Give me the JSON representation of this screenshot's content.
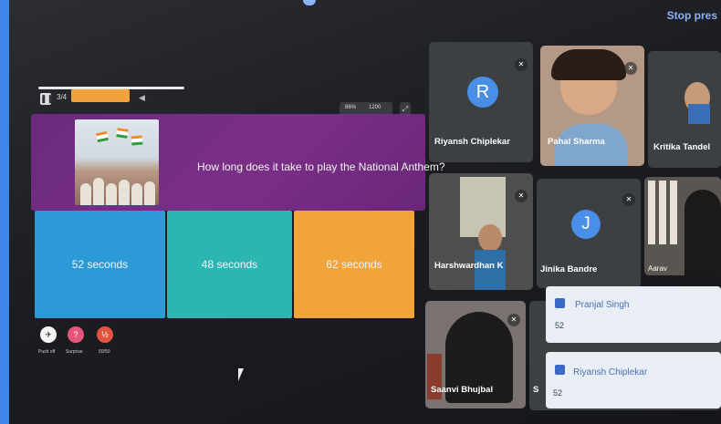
{
  "meet": {
    "stop_presenting_label": "Stop pres"
  },
  "quiz": {
    "question_number": "3/4",
    "stats": {
      "correct": "86%",
      "score": "1200"
    },
    "question": "How long does it take to play the National Anthem?",
    "answers": [
      "52 seconds",
      "48 seconds",
      "62 seconds"
    ],
    "answer_colors": [
      "#2b9ad6",
      "#2bb6b2",
      "#f0a43a"
    ],
    "powerups": [
      "Push off",
      "Surprise",
      "50/50"
    ]
  },
  "participants": [
    {
      "name": "Riyansh Chiplekar",
      "initial": "R",
      "avatar_color": "#4a8fe7"
    },
    {
      "name": "Pahal Sharma"
    },
    {
      "name": "Kritika Tandel"
    },
    {
      "name": "Harshwardhan K"
    },
    {
      "name": "Jinika Bandre",
      "initial": "J",
      "avatar_color": "#4a8fe7"
    },
    {
      "name": "Aarav"
    },
    {
      "name": "Saanvi Bhujbal"
    },
    {
      "name": "S"
    }
  ],
  "chat_popups": [
    {
      "name": "Pranjal Singh",
      "message": "52"
    },
    {
      "name": "Riyansh Chiplekar",
      "message": "52"
    }
  ]
}
